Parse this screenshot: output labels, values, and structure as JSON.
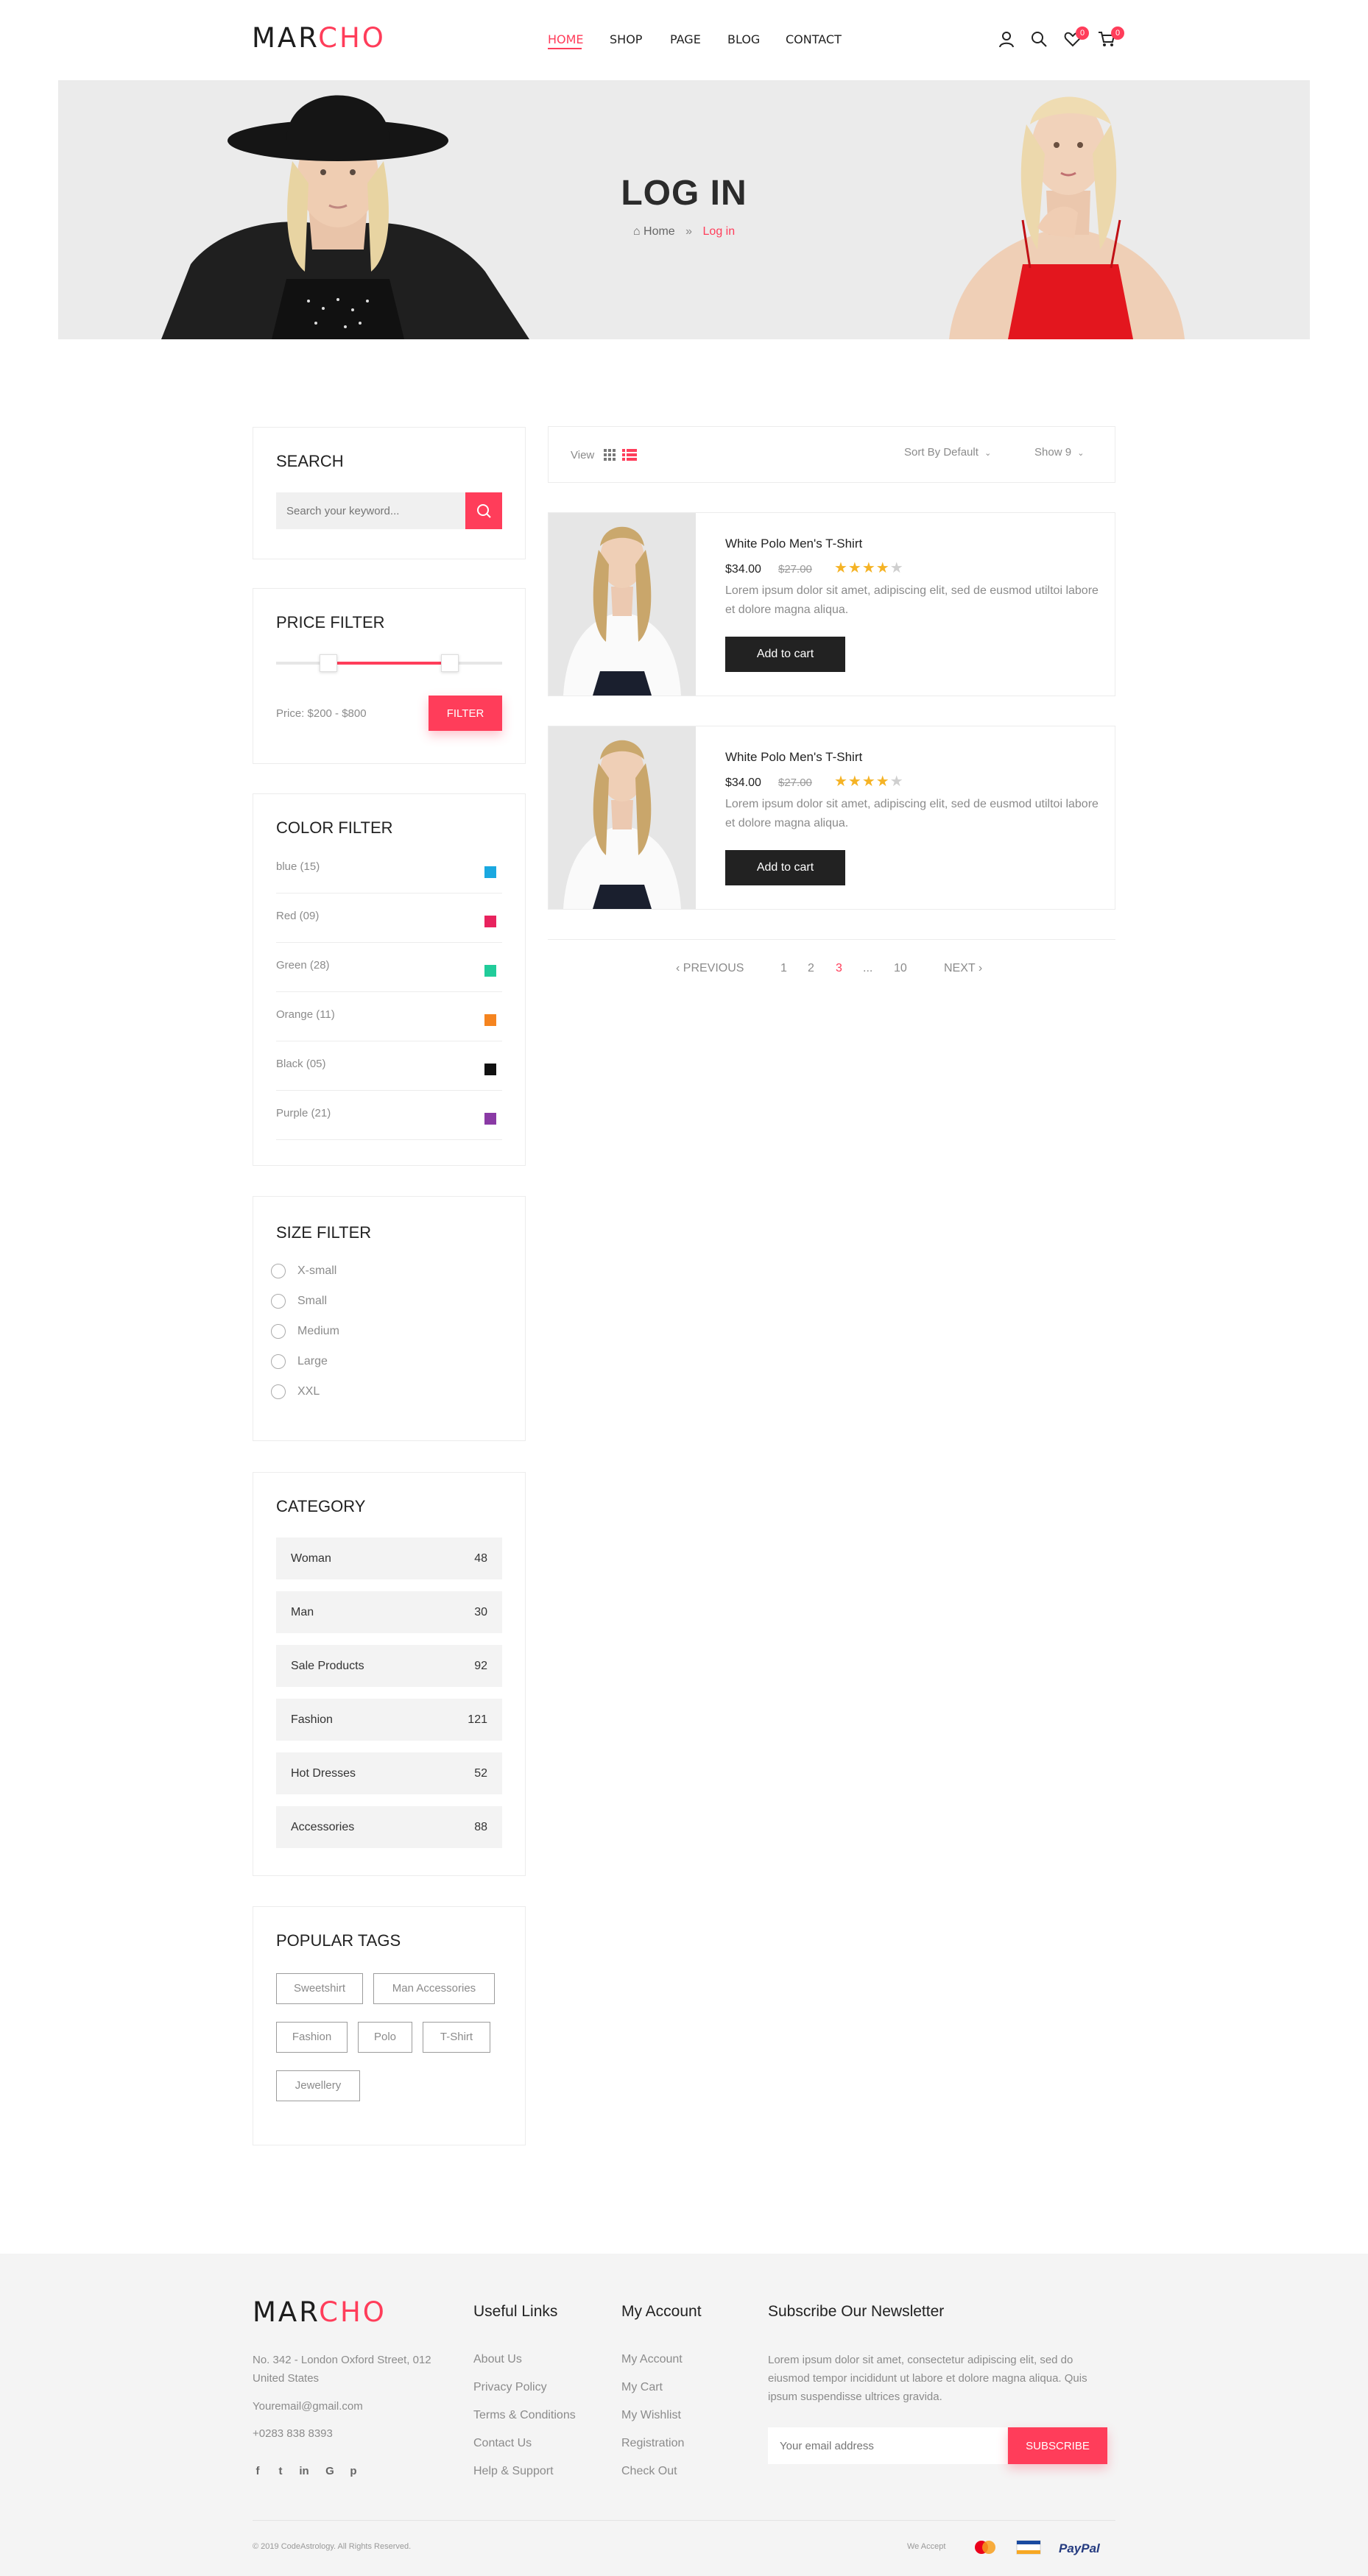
{
  "brand": {
    "part1": "MAR",
    "part2": "CHO"
  },
  "nav": {
    "items": [
      "HOME",
      "SHOP",
      "PAGE",
      "BLOG",
      "CONTACT"
    ]
  },
  "header": {
    "wishlist_count": "0",
    "cart_count": "0"
  },
  "hero": {
    "title": "LOG IN",
    "crumb_home": "Home",
    "crumb_current": "Log in"
  },
  "sidebar": {
    "search": {
      "title": "SEARCH",
      "placeholder": "Search your keyword..."
    },
    "price": {
      "title": "PRICE FILTER",
      "label": "Price: $200 - $800",
      "button": "FILTER",
      "range_min_fraction": 0.23,
      "range_max_fraction": 0.77
    },
    "color": {
      "title": "COLOR FILTER",
      "items": [
        {
          "label": "blue (15)",
          "color": "#1aa8e0"
        },
        {
          "label": "Red (09)",
          "color": "#e8235e"
        },
        {
          "label": "Green (28)",
          "color": "#21cc9a"
        },
        {
          "label": "Orange (11)",
          "color": "#f5841f"
        },
        {
          "label": "Black (05)",
          "color": "#111111"
        },
        {
          "label": "Purple (21)",
          "color": "#8a3aa5"
        }
      ]
    },
    "size": {
      "title": "SIZE FILTER",
      "items": [
        "X-small",
        "Small",
        "Medium",
        "Large",
        "XXL"
      ]
    },
    "category": {
      "title": "CATEGORY",
      "items": [
        {
          "label": "Woman",
          "count": "48"
        },
        {
          "label": "Man",
          "count": "30"
        },
        {
          "label": "Sale Products",
          "count": "92"
        },
        {
          "label": "Fashion",
          "count": "121"
        },
        {
          "label": "Hot Dresses",
          "count": "52"
        },
        {
          "label": "Accessories",
          "count": "88"
        }
      ]
    },
    "tags": {
      "title": "POPULAR TAGS",
      "items": [
        "Sweetshirt",
        "Man Accessories",
        "Fashion",
        "Polo",
        "T-Shirt",
        "Jewellery"
      ]
    }
  },
  "toolbar": {
    "view_label": "View",
    "sort_label": "Sort By Default",
    "show_label": "Show 9"
  },
  "products": [
    {
      "title": "White Polo Men's T-Shirt",
      "price": "$34.00",
      "old_price": "$27.00",
      "rating": 4,
      "desc": "Lorem ipsum dolor sit amet, adipiscing elit, sed de eusmod utiltoi labore et dolore magna aliqua.",
      "button": "Add to cart"
    },
    {
      "title": "White Polo Men's T-Shirt",
      "price": "$34.00",
      "old_price": "$27.00",
      "rating": 4,
      "desc": "Lorem ipsum dolor sit amet, adipiscing elit, sed de eusmod utiltoi labore et dolore magna aliqua.",
      "button": "Add to cart"
    }
  ],
  "pagination": {
    "prev": "PREVIOUS",
    "pages": [
      "1",
      "2",
      "3",
      "...",
      "10"
    ],
    "active": "3",
    "next": "NEXT"
  },
  "footer": {
    "address": "No. 342 - London Oxford Street, 012 United States",
    "email": "Youremail@gmail.com",
    "phone": "+0283 838 8393",
    "useful_title": "Useful Links",
    "useful_links": [
      "About Us",
      "Privacy Policy",
      "Terms & Conditions",
      "Contact Us",
      "Help & Support"
    ],
    "account_title": "My Account",
    "account_links": [
      "My Account",
      "My Cart",
      "My Wishlist",
      "Registration",
      "Check Out"
    ],
    "newsletter_title": "Subscribe Our Newsletter",
    "newsletter_text": "Lorem ipsum dolor sit amet, consectetur adipiscing elit, sed do eiusmod tempor incididunt ut labore et dolore magna aliqua. Quis ipsum suspendisse ultrices gravida.",
    "email_placeholder": "Your email address",
    "subscribe": "SUBSCRIBE",
    "copyright": "© 2019 CodeAstrology. All Rights Reserved.",
    "we_accept": "We Accept",
    "paypal": "PayPal"
  },
  "colors": {
    "accent": "#ff3d5a",
    "dark": "#222222"
  }
}
